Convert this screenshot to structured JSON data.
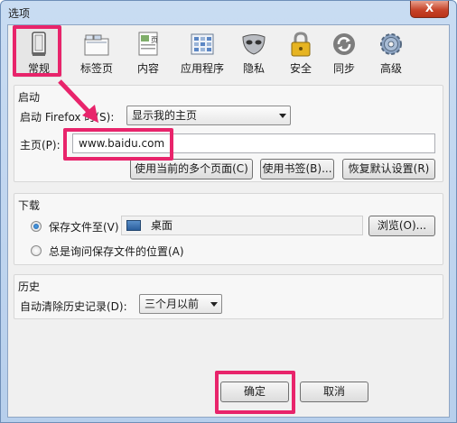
{
  "window": {
    "title": "选项",
    "close_label": "X"
  },
  "panes": [
    {
      "label": "常规",
      "icon": "general-icon"
    },
    {
      "label": "标签页",
      "icon": "tabs-icon"
    },
    {
      "label": "内容",
      "icon": "content-icon"
    },
    {
      "label": "应用程序",
      "icon": "applications-icon"
    },
    {
      "label": "隐私",
      "icon": "privacy-icon"
    },
    {
      "label": "安全",
      "icon": "security-icon"
    },
    {
      "label": "同步",
      "icon": "sync-icon"
    },
    {
      "label": "高级",
      "icon": "advanced-icon"
    }
  ],
  "pane_icon_page_text": "页",
  "startup": {
    "group_title": "启动",
    "when_label": "启动 Firefox 时(S):",
    "when_value": "显示我的主页",
    "homepage_label": "主页(P):",
    "homepage_value": "www.baidu.com",
    "use_current_label": "使用当前的多个页面(C)",
    "use_bookmark_label": "使用书签(B)...",
    "restore_default_label": "恢复默认设置(R)"
  },
  "downloads": {
    "group_title": "下载",
    "save_to_label": "保存文件至(V)",
    "save_to_value": "桌面",
    "browse_label": "浏览(O)...",
    "always_ask_label": "总是询问保存文件的位置(A)"
  },
  "history": {
    "group_title": "历史",
    "auto_clear_label": "自动清除历史记录(D):",
    "auto_clear_value": "三个月以前"
  },
  "footer": {
    "ok_label": "确定",
    "cancel_label": "取消"
  },
  "colors": {
    "highlight": "#e8246b",
    "accent": "#2b5f9d"
  }
}
